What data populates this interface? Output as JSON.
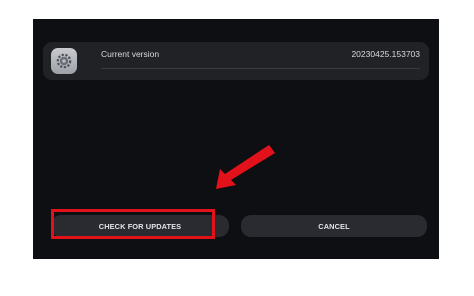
{
  "version_card": {
    "label": "Current version",
    "value": "20230425.153703",
    "icon": "gear-icon"
  },
  "buttons": {
    "check_label": "CHECK FOR UPDATES",
    "cancel_label": "CANCEL"
  },
  "annotation": {
    "color": "#e3121a"
  }
}
